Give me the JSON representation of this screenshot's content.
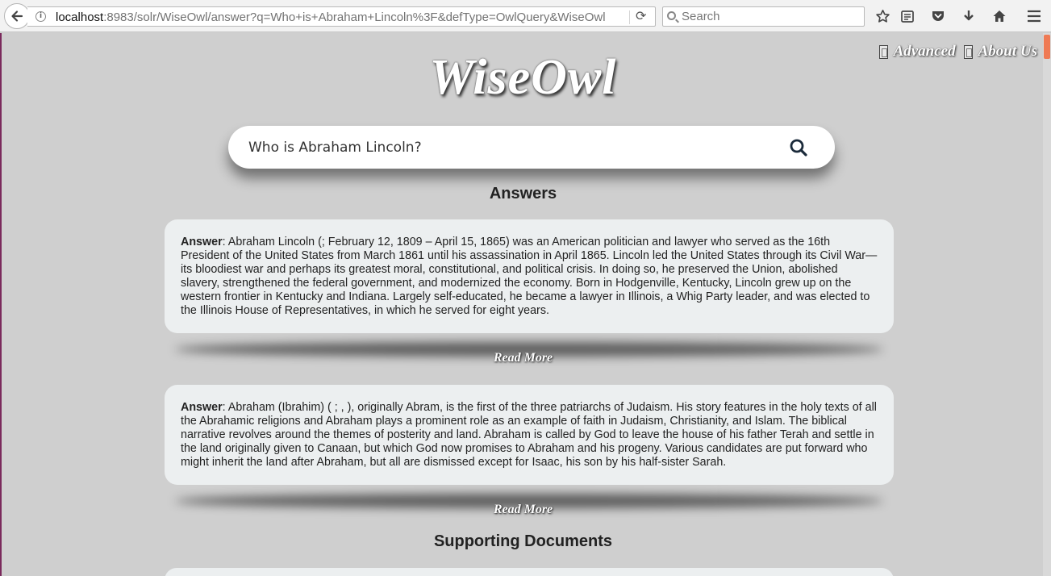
{
  "browser": {
    "url_host": "localhost",
    "url_rest": ":8983/solr/WiseOwl/answer?q=Who+is+Abraham+Lincoln%3F&defType=OwlQuery&WiseOwl",
    "search_placeholder": "Search"
  },
  "nav": {
    "advanced": "Advanced",
    "about": "About Us"
  },
  "logo": "WiseOwl",
  "search": {
    "value": "Who is Abraham Lincoln?"
  },
  "answers_title": "Answers",
  "answers": [
    {
      "label": "Answer",
      "text": ": Abraham Lincoln (; February 12, 1809 – April 15, 1865) was an American politician and lawyer who served as the 16th President of the United States from March 1861 until his assassination in April 1865. Lincoln led the United States through its Civil War—its bloodiest war and perhaps its greatest moral, constitutional, and political crisis. In doing so, he preserved the Union, abolished slavery, strengthened the federal government, and modernized the economy. Born in Hodgenville, Kentucky, Lincoln grew up on the western frontier in Kentucky and Indiana. Largely self-educated, he became a lawyer in Illinois, a Whig Party leader, and was elected to the Illinois House of Representatives, in which he served for eight years.",
      "read_more": "Read More"
    },
    {
      "label": "Answer",
      "text": ": Abraham (Ibrahim) ( ; , ), originally Abram, is the first of the three patriarchs of Judaism. His story features in the holy texts of all the Abrahamic religions and Abraham plays a prominent role as an example of faith in Judaism, Christianity, and Islam. The biblical narrative revolves around the themes of posterity and land. Abraham is called by God to leave the house of his father Terah and settle in the land originally given to Canaan, but which God now promises to Abraham and his progeny. Various candidates are put forward who might inherit the land after Abraham, but all are dismissed except for Isaac, his son by his half-sister Sarah.",
      "read_more": "Read More"
    }
  ],
  "supporting_title": "Supporting Documents"
}
